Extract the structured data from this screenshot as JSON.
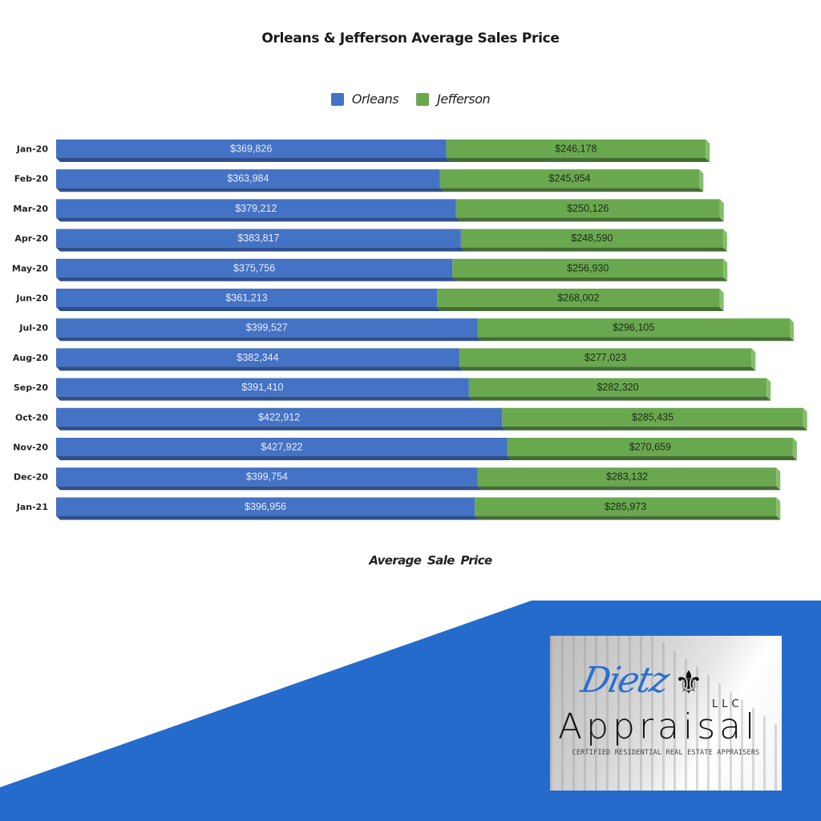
{
  "colors": {
    "orleans": "#4472c4",
    "orleans_shadow": "#2f4f8c",
    "jefferson": "#6aa84f",
    "jefferson_shadow": "#456e34",
    "jefferson_end": "#86bd6c",
    "background_accent": "#256bcc"
  },
  "chart_data": {
    "type": "bar",
    "orientation": "horizontal",
    "stacked": true,
    "title": "Orleans & Jefferson Average Sales Price",
    "xlabel": "Average  Sale Price",
    "ylabel": "",
    "legend_position": "top-center",
    "grid": false,
    "xlim": [
      0,
      780000
    ],
    "categories": [
      "Jan-20",
      "Feb-20",
      "Mar-20",
      "Apr-20",
      "May-20",
      "Jun-20",
      "Jul-20",
      "Aug-20",
      "Sep-20",
      "Oct-20",
      "Nov-20",
      "Dec-20",
      "Jan-21"
    ],
    "series": [
      {
        "name": "Orleans",
        "values": [
          369826,
          363984,
          379212,
          383817,
          375756,
          361213,
          399527,
          382344,
          391410,
          422912,
          427922,
          399754,
          396956
        ],
        "labels": [
          "$369,826",
          "$363,984",
          "$379,212",
          "$383,817",
          "$375,756",
          "$361,213",
          "$399,527",
          "$382,344",
          "$391,410",
          "$422,912",
          "$427,922",
          "$399,754",
          "$396,956"
        ]
      },
      {
        "name": "Jefferson",
        "values": [
          246178,
          245954,
          250126,
          248590,
          256930,
          268002,
          296105,
          277023,
          282320,
          285435,
          270659,
          283132,
          285973
        ],
        "labels": [
          "$246,178",
          "$245,954",
          "$250,126",
          "$248,590",
          "$256,930",
          "$268,002",
          "$296,105",
          "$277,023",
          "$282,320",
          "$285,435",
          "$270,659",
          "$283,132",
          "$285,973"
        ]
      }
    ]
  },
  "logo": {
    "script_text": "Dietz",
    "fleur_icon": "⚜",
    "suffix": "LLC",
    "word": "Appraisal",
    "tagline": "CERTIFIED RESIDENTIAL REAL ESTATE APPRAISERS"
  }
}
